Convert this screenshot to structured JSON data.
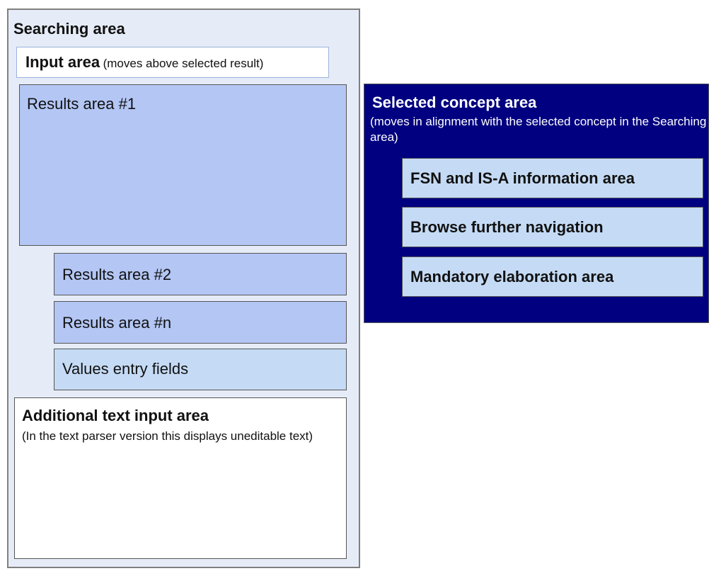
{
  "searching_area": {
    "title": "Searching area",
    "input_area": {
      "label": "Input area",
      "note": "(moves above selected result)"
    },
    "results": [
      "Results area #1",
      "Results area #2",
      "Results area #n"
    ],
    "values_entry": "Values entry fields",
    "additional_text": {
      "title": "Additional text input area",
      "note": "(In the text parser version this displays uneditable text)"
    }
  },
  "selected_concept_area": {
    "title": "Selected concept area",
    "note": "(moves in alignment with the selected concept in the Searching area)",
    "items": [
      "FSN and IS-A information area",
      "Browse further navigation",
      "Mandatory elaboration area"
    ]
  },
  "colors": {
    "searching_bg": "#e6ecf7",
    "results_fill": "#b3c6f4",
    "light_fill": "#c5dbf5",
    "selected_bg": "#000080"
  }
}
